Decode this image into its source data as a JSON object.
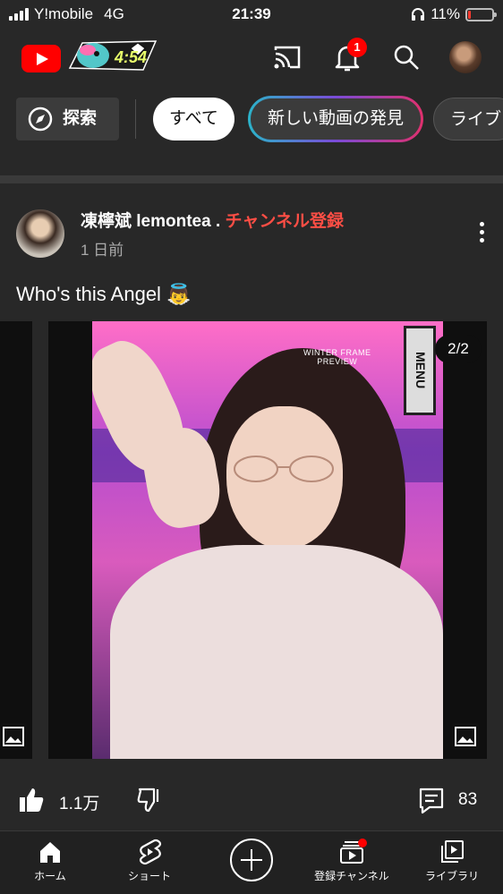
{
  "status_bar": {
    "carrier": "Y!mobile",
    "network": "4G",
    "time": "21:39",
    "battery": "11%",
    "battery_level": 0.11
  },
  "header": {
    "doodle_time": "4:54",
    "notification_count": "1"
  },
  "chips": {
    "explore": "探索",
    "all": "すべて",
    "discover": "新しい動画の発見",
    "library": "ライブ"
  },
  "post": {
    "channel_name": "凍檸斌 lemontea",
    "separator": " . ",
    "subscribe": "チャンネル登録",
    "time_ago": "1 日前",
    "text": "Who's this Angel 👼",
    "image_counter": "2/2",
    "watermark_line1": "WINTER FRAME",
    "watermark_line2": "PREVIEW",
    "sign_text": "MENU"
  },
  "actions": {
    "likes": "1.1万",
    "comments": "83"
  },
  "bottom_nav": {
    "home": "ホーム",
    "shorts": "ショート",
    "subscriptions": "登録チャンネル",
    "library": "ライブラリ"
  },
  "colors": {
    "background": "#282828",
    "accent_red": "#ff0000",
    "subscribe_red": "#ff4e45"
  }
}
